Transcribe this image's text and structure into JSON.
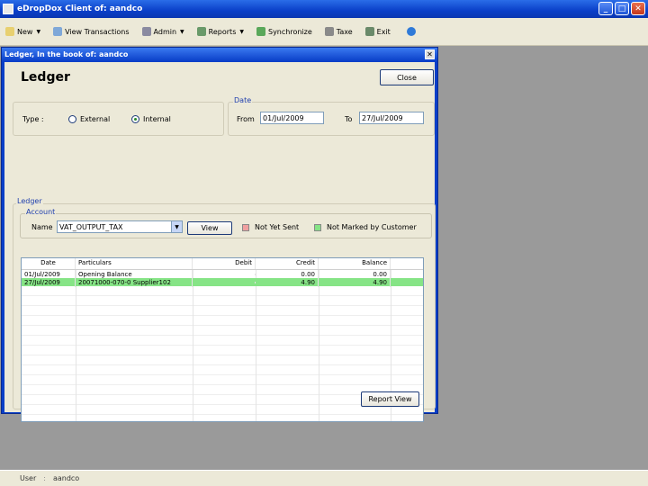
{
  "window": {
    "title": "eDropDox Client of: aandco",
    "min": "_",
    "max": "□",
    "close": "✕"
  },
  "toolbar": {
    "items": [
      {
        "label": "New",
        "icon": "new-document-icon",
        "color": "#e8d070",
        "dropdown": true
      },
      {
        "label": "View Transactions",
        "icon": "view-icon",
        "color": "#7fa8d8",
        "dropdown": false
      },
      {
        "label": "Admin",
        "icon": "admin-icon",
        "color": "#8a8aa0",
        "dropdown": true
      },
      {
        "label": "Reports",
        "icon": "reports-icon",
        "color": "#6a9a6a",
        "dropdown": true
      },
      {
        "label": "Synchronize",
        "icon": "sync-icon",
        "color": "#5aa85a",
        "dropdown": false
      },
      {
        "label": "Taxe",
        "icon": "tax-icon",
        "color": "#8a8a8a",
        "dropdown": false
      },
      {
        "label": "Exit",
        "icon": "exit-icon",
        "color": "#6a8a6a",
        "dropdown": false
      }
    ]
  },
  "status": {
    "user_label": "User",
    "user_value": "aandco"
  },
  "ledger_window": {
    "title": "Ledger, In the book of: aandco",
    "heading": "Ledger",
    "close_button": "Close",
    "type": {
      "label": "Type :",
      "external": "External",
      "internal": "Internal",
      "selected": "internal"
    },
    "date": {
      "group_label": "Date",
      "from_label": "From",
      "from_value": "01/Jul/2009",
      "to_label": "To",
      "to_value": "27/Jul/2009"
    },
    "ledger_group_label": "Ledger",
    "account": {
      "group_label": "Account",
      "name_label": "Name",
      "name_value": "VAT_OUTPUT_TAX",
      "view_button": "View"
    },
    "legend": {
      "not_yet_sent": "Not Yet Sent",
      "not_yet_sent_color": "#f0a0a0",
      "not_marked": "Not Marked by Customer",
      "not_marked_color": "#86e486"
    },
    "table": {
      "headers": [
        "Date",
        "Particulars",
        "Debit",
        "Credit",
        "Balance"
      ],
      "rows": [
        {
          "date": "01/Jul/2009",
          "particulars": "Opening Balance",
          "debit": "",
          "credit": "0.00",
          "balance": "0.00",
          "highlight": false
        },
        {
          "date": "27/Jul/2009",
          "particulars": "20071000-070-0 Supplier102",
          "debit": "",
          "credit": "4.90",
          "balance": "4.90",
          "highlight": true
        }
      ]
    },
    "report_button": "Report View"
  }
}
